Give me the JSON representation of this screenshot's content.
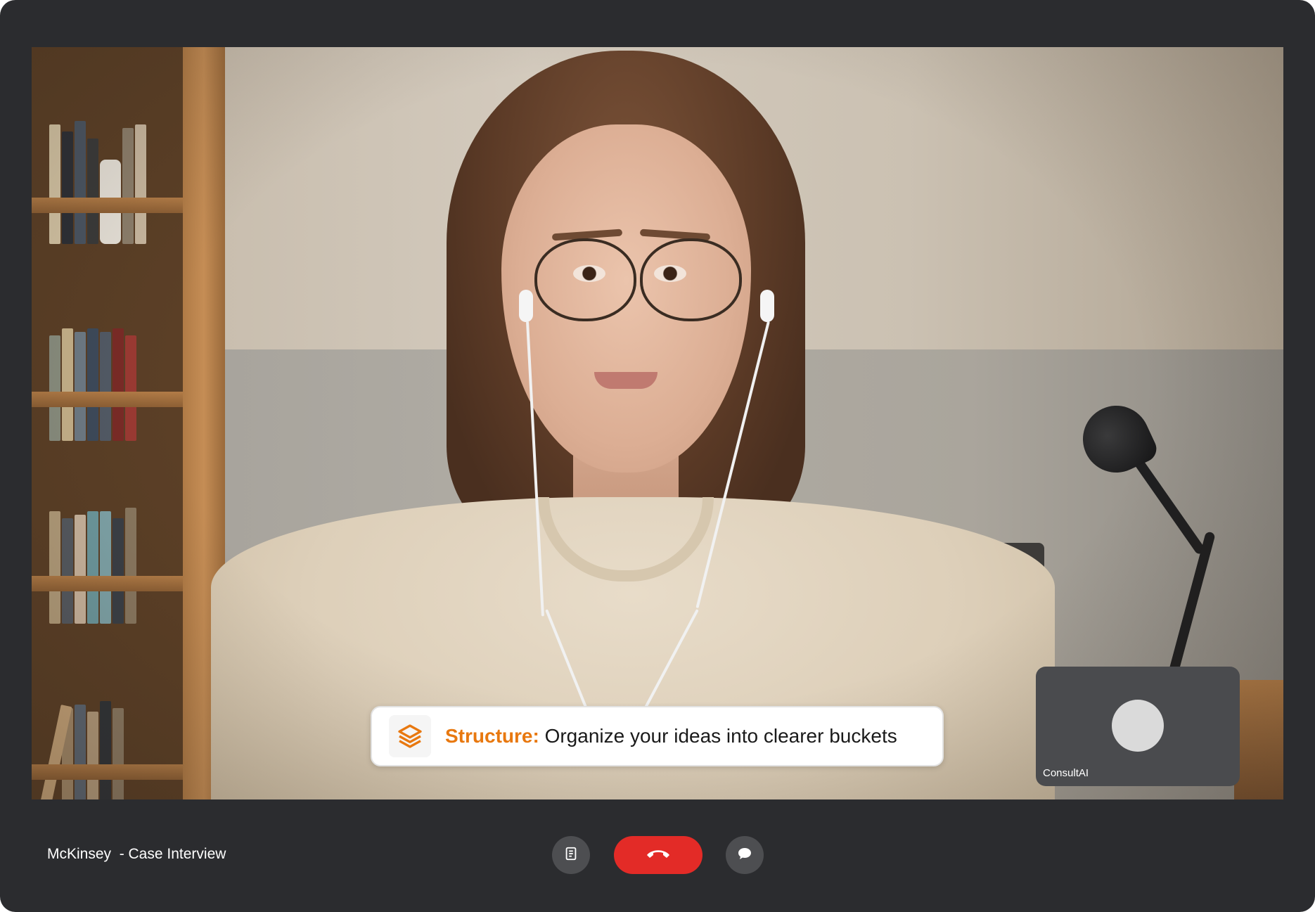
{
  "meeting": {
    "title": "McKinsey  - Case Interview"
  },
  "hint": {
    "label": "Structure:",
    "text": " Organize your ideas into clearer buckets",
    "icon": "layers-icon",
    "accent_color": "#e8780f"
  },
  "self_view": {
    "name": "ConsultAI"
  },
  "controls": {
    "notes_icon": "notes-icon",
    "end_call_icon": "phone-hangup-icon",
    "chat_icon": "chat-bubble-icon",
    "end_call_color": "#e32b27"
  },
  "colors": {
    "window_background": "#2b2c2f",
    "control_button": "#4d4e51"
  }
}
